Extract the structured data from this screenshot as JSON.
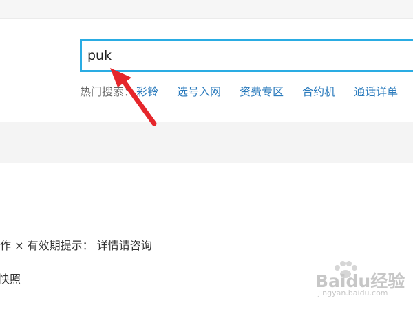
{
  "search": {
    "value": "puk"
  },
  "hot_search": {
    "label": "热门搜索：",
    "links": [
      "彩铃",
      "选号入网",
      "资费专区",
      "合约机",
      "通话详单"
    ]
  },
  "result": {
    "text_part1": "作",
    "close_symbol": "×",
    "text_part2": " 有效期提示： 详情请咨询",
    "snapshot": "快照"
  },
  "watermark": {
    "logo": "Baidu经验",
    "url": "jingyan.baidu.com"
  },
  "colors": {
    "search_border": "#2aace3",
    "link": "#2b7bbd",
    "arrow": "#e5262b"
  }
}
